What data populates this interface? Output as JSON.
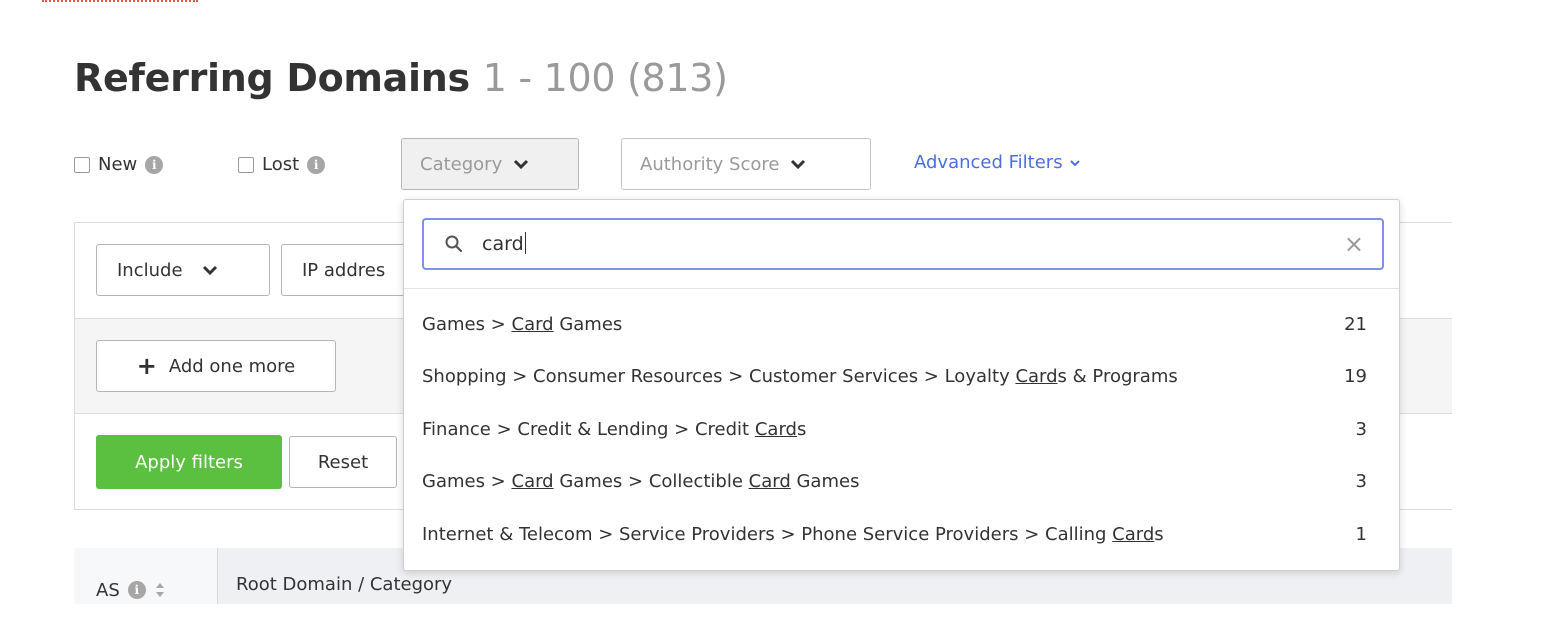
{
  "header": {
    "title": "Referring Domains",
    "range": "1 - 100 (813)"
  },
  "filters": {
    "new_label": "New",
    "lost_label": "Lost",
    "category_label": "Category",
    "authority_label": "Authority Score",
    "advanced_label": "Advanced Filters"
  },
  "panel": {
    "include_label": "Include",
    "ip_label": "IP addres",
    "add_more_label": "Add one more",
    "apply_label": "Apply filters",
    "reset_label": "Reset"
  },
  "table": {
    "col_as": "AS",
    "col_root": "Root Domain / Category"
  },
  "category_dropdown": {
    "search_value": "card",
    "options": [
      {
        "parts": [
          "Games > ",
          "Card",
          " Games"
        ],
        "count": "21"
      },
      {
        "parts": [
          "Shopping > Consumer Resources > Customer Services > Loyalty ",
          "Card",
          "s & Programs"
        ],
        "count": "19"
      },
      {
        "parts": [
          "Finance > Credit & Lending > Credit ",
          "Card",
          "s"
        ],
        "count": "3"
      },
      {
        "parts": [
          "Games > ",
          "Card",
          " Games > Collectible ",
          "Card",
          " Games"
        ],
        "count": "3"
      },
      {
        "parts": [
          "Internet & Telecom > Service Providers > Phone Service Providers > Calling ",
          "Card",
          "s"
        ],
        "count": "1"
      }
    ]
  },
  "colors": {
    "accent_blue": "#4a6fe0",
    "apply_green": "#5bbf3f"
  }
}
